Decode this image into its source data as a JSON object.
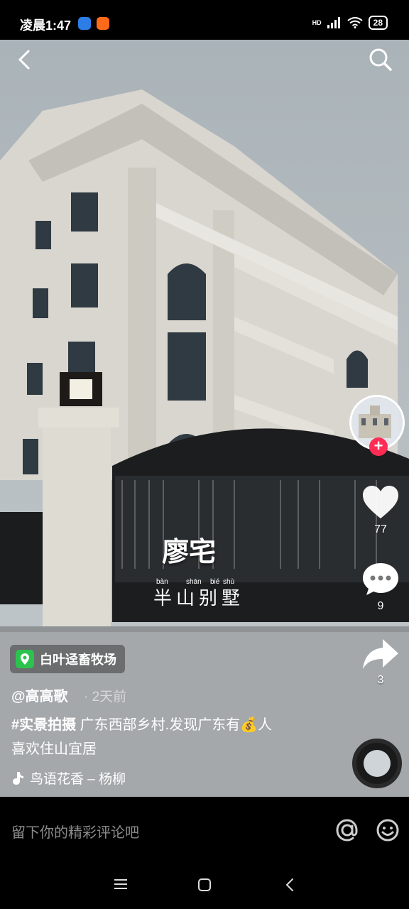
{
  "status": {
    "time": "凌晨1:47",
    "network": "HD",
    "battery": "28"
  },
  "video": {
    "overlay_title": "廖宅",
    "overlay_subtitle": "半山别墅",
    "pinyin": [
      "bàn",
      "shān",
      "bié",
      "shù"
    ]
  },
  "actions": {
    "likes": "77",
    "comments": "9",
    "shares": "3",
    "follow_symbol": "+"
  },
  "location": {
    "name": "白叶迳畜牧场"
  },
  "post": {
    "author": "@高高歌",
    "time_ago": "· 2天前",
    "hashtag": "#实景拍摄",
    "text_line1": " 广东西部乡村.发现广东有💰人",
    "text_line2": "喜欢住山宜居",
    "music": "鸟语花香 – 杨柳"
  },
  "comment_bar": {
    "placeholder": "留下你的精彩评论吧"
  },
  "icons": {
    "back": "back-icon",
    "search": "search-icon",
    "like": "heart-icon",
    "comment": "comment-icon",
    "share": "share-icon",
    "mention": "at-icon",
    "emoji": "emoji-icon"
  },
  "colors": {
    "follow": "#fe2c55",
    "location_pin": "#2bc34e"
  }
}
